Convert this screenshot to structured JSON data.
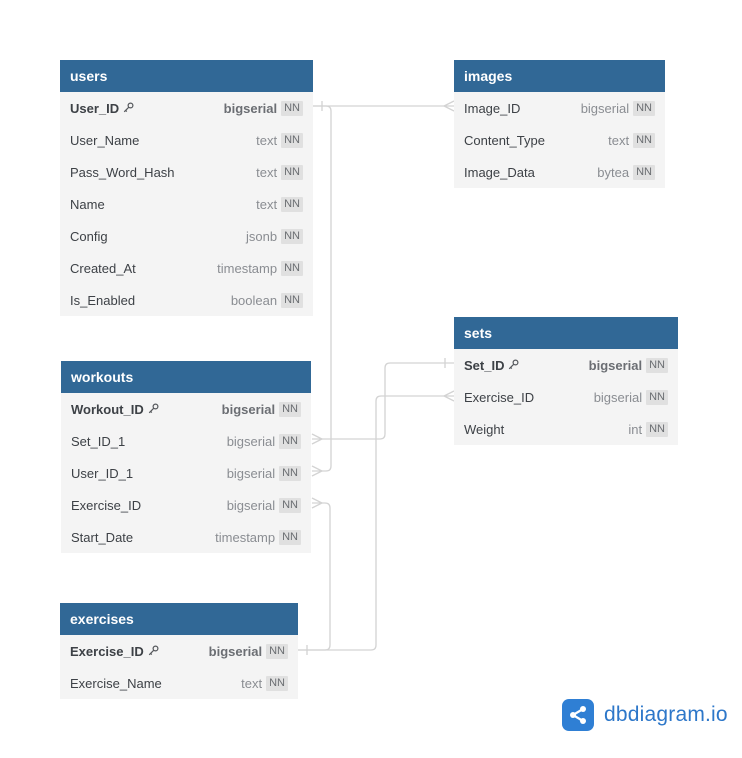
{
  "colors": {
    "header_bg": "#316896",
    "header_text": "#ffffff",
    "table_bg": "#f4f4f4",
    "connector": "#d3d3d3",
    "brand": "#2d77c9"
  },
  "brand": {
    "label": "dbdiagram.io",
    "icon": "share-nodes-icon"
  },
  "tables": {
    "users": {
      "title": "users",
      "columns": [
        {
          "name": "User_ID",
          "type": "bigserial",
          "nn": "NN",
          "pk": true
        },
        {
          "name": "User_Name",
          "type": "text",
          "nn": "NN"
        },
        {
          "name": "Pass_Word_Hash",
          "type": "text",
          "nn": "NN"
        },
        {
          "name": "Name",
          "type": "text",
          "nn": "NN"
        },
        {
          "name": "Config",
          "type": "jsonb",
          "nn": "NN"
        },
        {
          "name": "Created_At",
          "type": "timestamp",
          "nn": "NN"
        },
        {
          "name": "Is_Enabled",
          "type": "boolean",
          "nn": "NN"
        }
      ]
    },
    "images": {
      "title": "images",
      "columns": [
        {
          "name": "Image_ID",
          "type": "bigserial",
          "nn": "NN"
        },
        {
          "name": "Content_Type",
          "type": "text",
          "nn": "NN"
        },
        {
          "name": "Image_Data",
          "type": "bytea",
          "nn": "NN"
        }
      ]
    },
    "sets": {
      "title": "sets",
      "columns": [
        {
          "name": "Set_ID",
          "type": "bigserial",
          "nn": "NN",
          "pk": true
        },
        {
          "name": "Exercise_ID",
          "type": "bigserial",
          "nn": "NN"
        },
        {
          "name": "Weight",
          "type": "int",
          "nn": "NN"
        }
      ]
    },
    "workouts": {
      "title": "workouts",
      "columns": [
        {
          "name": "Workout_ID",
          "type": "bigserial",
          "nn": "NN",
          "pk": true
        },
        {
          "name": "Set_ID_1",
          "type": "bigserial",
          "nn": "NN"
        },
        {
          "name": "User_ID_1",
          "type": "bigserial",
          "nn": "NN"
        },
        {
          "name": "Exercise_ID",
          "type": "bigserial",
          "nn": "NN"
        },
        {
          "name": "Start_Date",
          "type": "timestamp",
          "nn": "NN"
        }
      ]
    },
    "exercises": {
      "title": "exercises",
      "columns": [
        {
          "name": "Exercise_ID",
          "type": "bigserial",
          "nn": "NN",
          "pk": true
        },
        {
          "name": "Exercise_Name",
          "type": "text",
          "nn": "NN"
        }
      ]
    }
  },
  "relationships": [
    {
      "from": "users.User_ID",
      "to": "images.Image_ID",
      "from_end": "one",
      "to_end": "many"
    },
    {
      "from": "users.User_ID",
      "to": "workouts.User_ID_1",
      "from_end": "one",
      "to_end": "many"
    },
    {
      "from": "sets.Set_ID",
      "to": "workouts.Set_ID_1",
      "from_end": "one",
      "to_end": "many"
    },
    {
      "from": "exercises.Exercise_ID",
      "to": "workouts.Exercise_ID",
      "from_end": "one",
      "to_end": "many"
    },
    {
      "from": "exercises.Exercise_ID",
      "to": "sets.Exercise_ID",
      "from_end": "one",
      "to_end": "many"
    }
  ]
}
